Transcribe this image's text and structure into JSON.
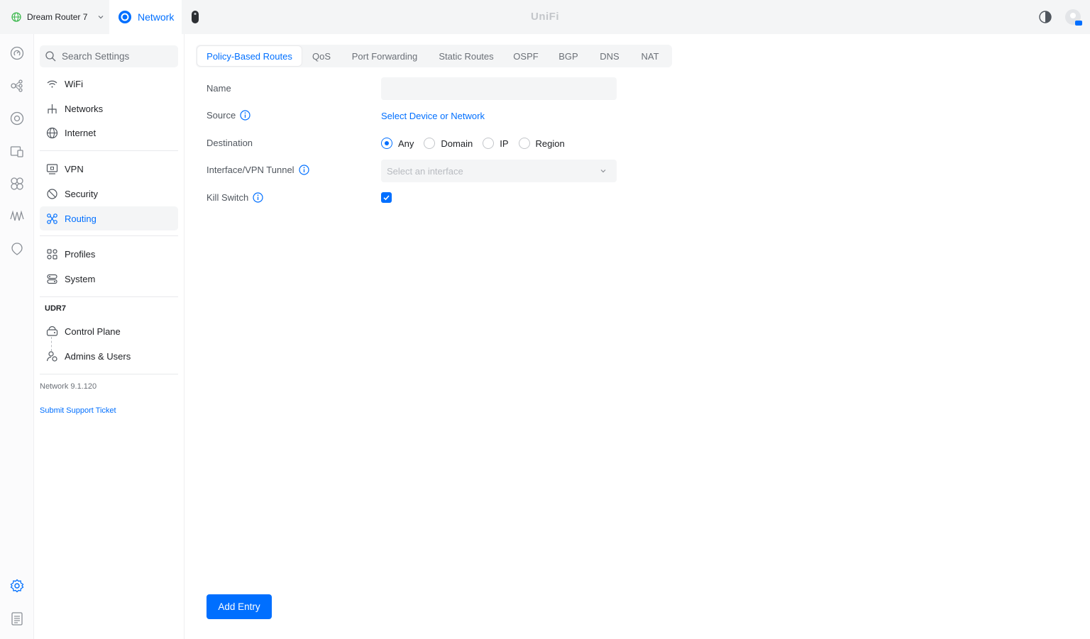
{
  "topbar": {
    "device_name": "Dream Router 7",
    "app_tab": "Network",
    "brand": "UniFi",
    "icons": [
      "globe-icon",
      "chevron-down-icon",
      "network-app-icon",
      "remote-device-icon",
      "theme-toggle-icon",
      "user-avatar"
    ]
  },
  "rail": {
    "icons": [
      "dashboard-icon",
      "topology-icon",
      "devices-icon",
      "client-devices-icon",
      "insights-icon",
      "traffic-icon",
      "alarm-icon",
      "settings-icon",
      "logs-icon"
    ]
  },
  "sidebar": {
    "search_placeholder": "Search Settings",
    "items": [
      {
        "label": "WiFi",
        "icon": "wifi-icon"
      },
      {
        "label": "Networks",
        "icon": "networks-icon"
      },
      {
        "label": "Internet",
        "icon": "internet-globe-icon"
      },
      {
        "label": "VPN",
        "icon": "vpn-icon"
      },
      {
        "label": "Security",
        "icon": "shield-icon"
      },
      {
        "label": "Routing",
        "icon": "routing-icon"
      },
      {
        "label": "Profiles",
        "icon": "profiles-icon"
      },
      {
        "label": "System",
        "icon": "system-icon"
      }
    ],
    "active_item": "Routing",
    "group_label": "UDR7",
    "device_items": [
      {
        "label": "Control Plane",
        "icon": "control-plane-icon"
      },
      {
        "label": "Admins & Users",
        "icon": "admins-icon"
      }
    ],
    "version": "Network 9.1.120",
    "support_link": "Submit Support Ticket"
  },
  "tabs": [
    {
      "label": "Policy-Based Routes"
    },
    {
      "label": "QoS"
    },
    {
      "label": "Port Forwarding"
    },
    {
      "label": "Static Routes"
    },
    {
      "label": "OSPF"
    },
    {
      "label": "BGP"
    },
    {
      "label": "DNS"
    },
    {
      "label": "NAT"
    }
  ],
  "active_tab": "Policy-Based Routes",
  "form": {
    "name_label": "Name",
    "name_value": "",
    "source_label": "Source",
    "source_link": "Select Device or Network",
    "destination_label": "Destination",
    "destination_options": [
      "Any",
      "Domain",
      "IP",
      "Region"
    ],
    "destination_selected": "Any",
    "interface_label": "Interface/VPN Tunnel",
    "interface_placeholder": "Select an interface",
    "kill_switch_label": "Kill Switch",
    "kill_switch_checked": true
  },
  "add_button": "Add Entry",
  "colors": {
    "accent": "#006fff",
    "topbar_bg": "#f4f5f6",
    "input_bg": "#f4f5f6"
  }
}
